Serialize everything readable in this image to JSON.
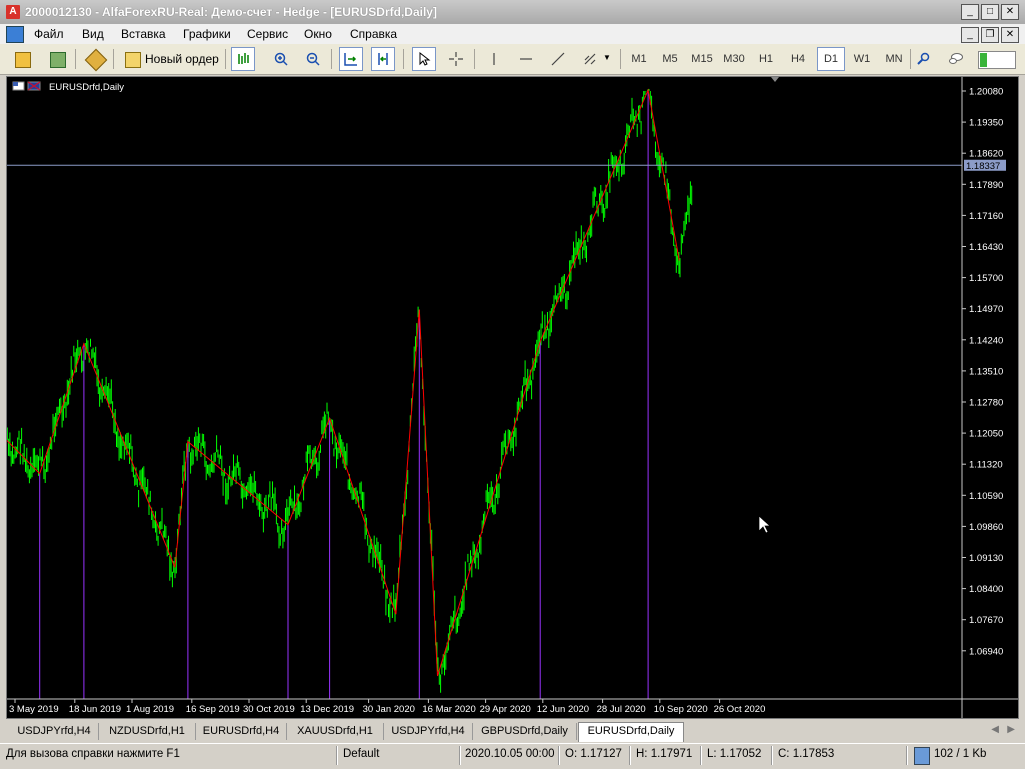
{
  "window": {
    "title": "2000012130 - AlfaForexRU-Real: Демо-счет - Hedge - [EURUSDrfd,Daily]"
  },
  "menu": {
    "items": [
      "Файл",
      "Вид",
      "Вставка",
      "Графики",
      "Сервис",
      "Окно",
      "Справка"
    ]
  },
  "toolbar": {
    "new_order_label": "Новый ордер",
    "timeframes": [
      "M1",
      "M5",
      "M15",
      "M30",
      "H1",
      "H4",
      "D1",
      "W1",
      "MN"
    ],
    "active_timeframe": "D1"
  },
  "chart": {
    "symbol_label": "EURUSDrfd,Daily",
    "current_price_label": "1.18337",
    "colors": {
      "bull": "#00ff00",
      "bear": "#00ff00",
      "zigzag": "#ff0000",
      "vline": "#9933ff",
      "bidline": "#8c9cc8"
    }
  },
  "chart_data": {
    "type": "ohlc",
    "price_ticks": [
      "1.20080",
      "1.19350",
      "1.18620",
      "1.17890",
      "1.17160",
      "1.16430",
      "1.15700",
      "1.14970",
      "1.14240",
      "1.13510",
      "1.12780",
      "1.12050",
      "1.11320",
      "1.10590",
      "1.09860",
      "1.09130",
      "1.08400",
      "1.07670",
      "1.06940"
    ],
    "date_ticks": [
      "3 May 2019",
      "18 Jun 2019",
      "1 Aug 2019",
      "16 Sep 2019",
      "30 Oct 2019",
      "13 Dec 2019",
      "30 Jan 2020",
      "16 Mar 2020",
      "29 Apr 2020",
      "12 Jun 2020",
      "28 Jul 2020",
      "10 Sep 2020",
      "26 Oct 2020"
    ],
    "current_price": 1.18337,
    "zigzag": [
      {
        "date": "2019-04-26",
        "price": 1.119
      },
      {
        "date": "2019-05-22",
        "price": 1.111
      },
      {
        "date": "2019-06-25",
        "price": 1.1415
      },
      {
        "date": "2019-09-03",
        "price": 1.089
      },
      {
        "date": "2019-09-13",
        "price": 1.1185
      },
      {
        "date": "2019-11-29",
        "price": 1.099
      },
      {
        "date": "2019-12-31",
        "price": 1.124
      },
      {
        "date": "2020-02-20",
        "price": 1.078
      },
      {
        "date": "2020-03-09",
        "price": 1.1495
      },
      {
        "date": "2020-03-23",
        "price": 1.0635
      },
      {
        "date": "2020-06-10",
        "price": 1.142
      },
      {
        "date": "2020-09-01",
        "price": 1.201
      },
      {
        "date": "2020-09-25",
        "price": 1.161
      }
    ],
    "last_bar": {
      "time": "2020.10.05 00:00",
      "open": 1.17127,
      "high": 1.17971,
      "low": 1.17052,
      "close": 1.17853
    }
  },
  "tabs": {
    "items": [
      "USDJPYrfd,H4",
      "NZDUSDrfd,H1",
      "EURUSDrfd,H4",
      "XAUUSDrfd,H1",
      "USDJPYrfd,H4",
      "GBPUSDrfd,Daily",
      "EURUSDrfd,Daily"
    ],
    "active": "EURUSDrfd,Daily"
  },
  "status": {
    "help": "Для вызова справки нажмите F1",
    "profile": "Default",
    "datetime": "2020.10.05 00:00",
    "open": "O: 1.17127",
    "high": "H: 1.17971",
    "low": "L: 1.17052",
    "close": "C: 1.17853",
    "traffic": "102 / 1 Kb"
  }
}
